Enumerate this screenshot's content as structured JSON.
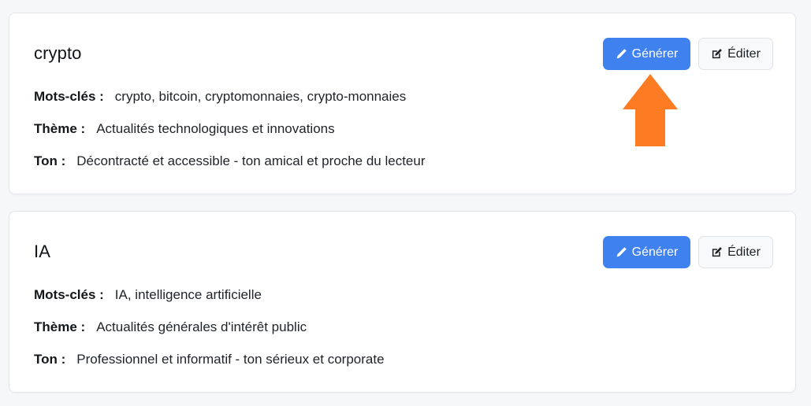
{
  "cards": [
    {
      "title": "crypto",
      "keywords_label": "Mots-clés :",
      "keywords_value": "crypto, bitcoin, cryptomonnaies, crypto-monnaies",
      "theme_label": "Thème :",
      "theme_value": "Actualités technologiques et innovations",
      "tone_label": "Ton :",
      "tone_value": "Décontracté et accessible - ton amical et proche du lecteur",
      "generate_label": "Générer",
      "edit_label": "Éditer"
    },
    {
      "title": "IA",
      "keywords_label": "Mots-clés :",
      "keywords_value": "IA, intelligence artificielle",
      "theme_label": "Thème :",
      "theme_value": "Actualités générales d'intérêt public",
      "tone_label": "Ton :",
      "tone_value": "Professionnel et informatif - ton sérieux et corporate",
      "generate_label": "Générer",
      "edit_label": "Éditer"
    }
  ],
  "icons": {
    "generate": "pencil-icon",
    "edit": "edit-square-icon",
    "annotation": "up-arrow-icon"
  },
  "colors": {
    "primary": "#3f82ef",
    "annotation_arrow": "#fd7c23",
    "page_background": "#f6f7f9",
    "card_background": "#ffffff"
  }
}
